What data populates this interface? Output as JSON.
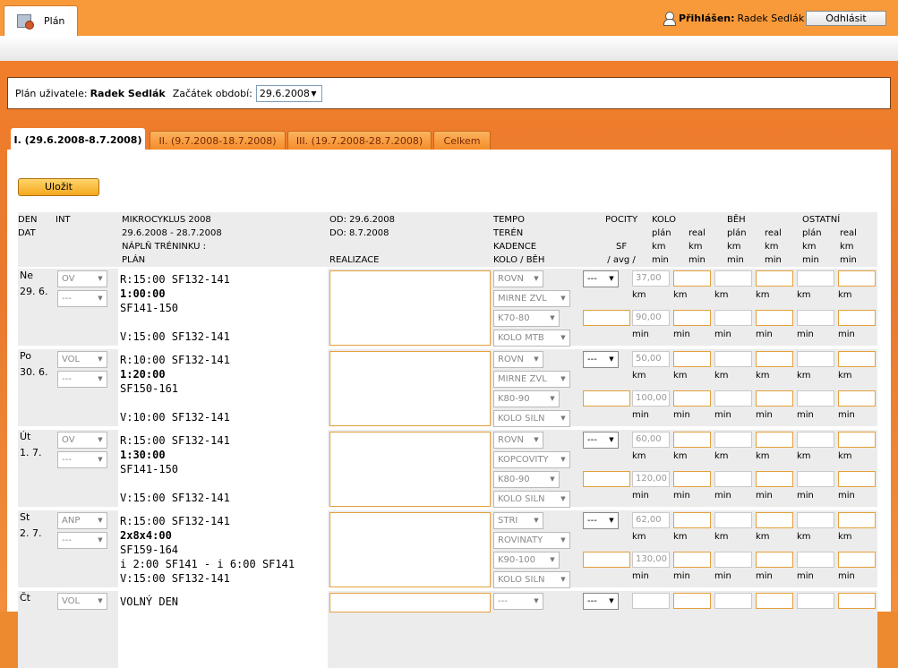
{
  "app": {
    "tab_label": "Plán",
    "logged_label": "Přihlášen:",
    "user": "Radek Sedlák",
    "logout": "Odhlásit"
  },
  "filter": {
    "user_label": "Plán uživatele:",
    "user": "Radek Sedlák",
    "period_label": "Začátek období:",
    "period_value": "29.6.2008"
  },
  "tabs": [
    "I. (29.6.2008-8.7.2008)",
    "II. (9.7.2008-18.7.2008)",
    "III. (19.7.2008-28.7.2008)",
    "Celkem"
  ],
  "save": "Uložit",
  "headers": {
    "den": "DEN\nDAT",
    "int": "INT",
    "mikro": "MIKROCYKLUS 2008\n29.6.2008 - 28.7.2008\nNÁPLŇ TRÉNINKU :\nPLÁN",
    "od": "OD: 29.6.2008\nDO: 8.7.2008\n\nREALIZACE",
    "tempo": "TEMPO\nTERÉN\nKADENCE\nKOLO / BĚH",
    "pocity": "POCITY\n\nSF\n/ avg /",
    "kolo": "KOLO\nplán\nkm\nmin",
    "real": "real\nkm\nmin",
    "beh": "BĚH\nplán\nkm\nmin",
    "beh_real": "real\nkm\nmin",
    "ost": "OSTATNÍ\nplán\nkm\nmin",
    "ost_real": "real\nkm\nmin"
  },
  "units": {
    "km": "km",
    "min": "min"
  },
  "rows": [
    {
      "day": "Ne",
      "date": "29. 6.",
      "int1": "OV",
      "int2": "---",
      "plan": [
        "R:15:00 SF132-141",
        "1:00:00",
        "SF141-150",
        "",
        "V:15:00 SF132-141"
      ],
      "tempo": "ROVN",
      "teren": "MIRNE ZVL",
      "kadence": "K70-80",
      "typ": "KOLO MTB",
      "pocity": "---",
      "km": "37,00",
      "min": "90,00"
    },
    {
      "day": "Po",
      "date": "30. 6.",
      "int1": "VOL",
      "int2": "---",
      "plan": [
        "R:10:00 SF132-141",
        "1:20:00",
        "SF150-161",
        "",
        "V:10:00 SF132-141"
      ],
      "tempo": "ROVN",
      "teren": "MIRNE ZVL",
      "kadence": "K80-90",
      "typ": "KOLO SILN",
      "pocity": "---",
      "km": "50,00",
      "min": "100,00"
    },
    {
      "day": "Út",
      "date": "1. 7.",
      "int1": "OV",
      "int2": "---",
      "plan": [
        "R:15:00 SF132-141",
        "1:30:00",
        "SF141-150",
        "",
        "V:15:00 SF132-141"
      ],
      "tempo": "ROVN",
      "teren": "KOPCOVITY",
      "kadence": "K80-90",
      "typ": "KOLO SILN",
      "pocity": "---",
      "km": "60,00",
      "min": "120,00"
    },
    {
      "day": "St",
      "date": "2. 7.",
      "int1": "ANP",
      "int2": "---",
      "plan": [
        "R:15:00 SF132-141",
        "2x8x4:00",
        "SF159-164",
        "i 2:00 SF141 - i 6:00 SF141",
        "V:15:00 SF132-141"
      ],
      "tempo": "STRI",
      "teren": "ROVINATY",
      "kadence": "K90-100",
      "typ": "KOLO SILN",
      "pocity": "---",
      "km": "62,00",
      "min": "130,00"
    },
    {
      "day": "Čt",
      "date": "",
      "int1": "VOL",
      "int2": "",
      "plan": [
        "VOLNÝ DEN",
        "",
        "",
        "",
        ""
      ],
      "tempo": "---",
      "teren": "",
      "kadence": "",
      "typ": "",
      "pocity": "---",
      "km": "",
      "min": ""
    }
  ]
}
